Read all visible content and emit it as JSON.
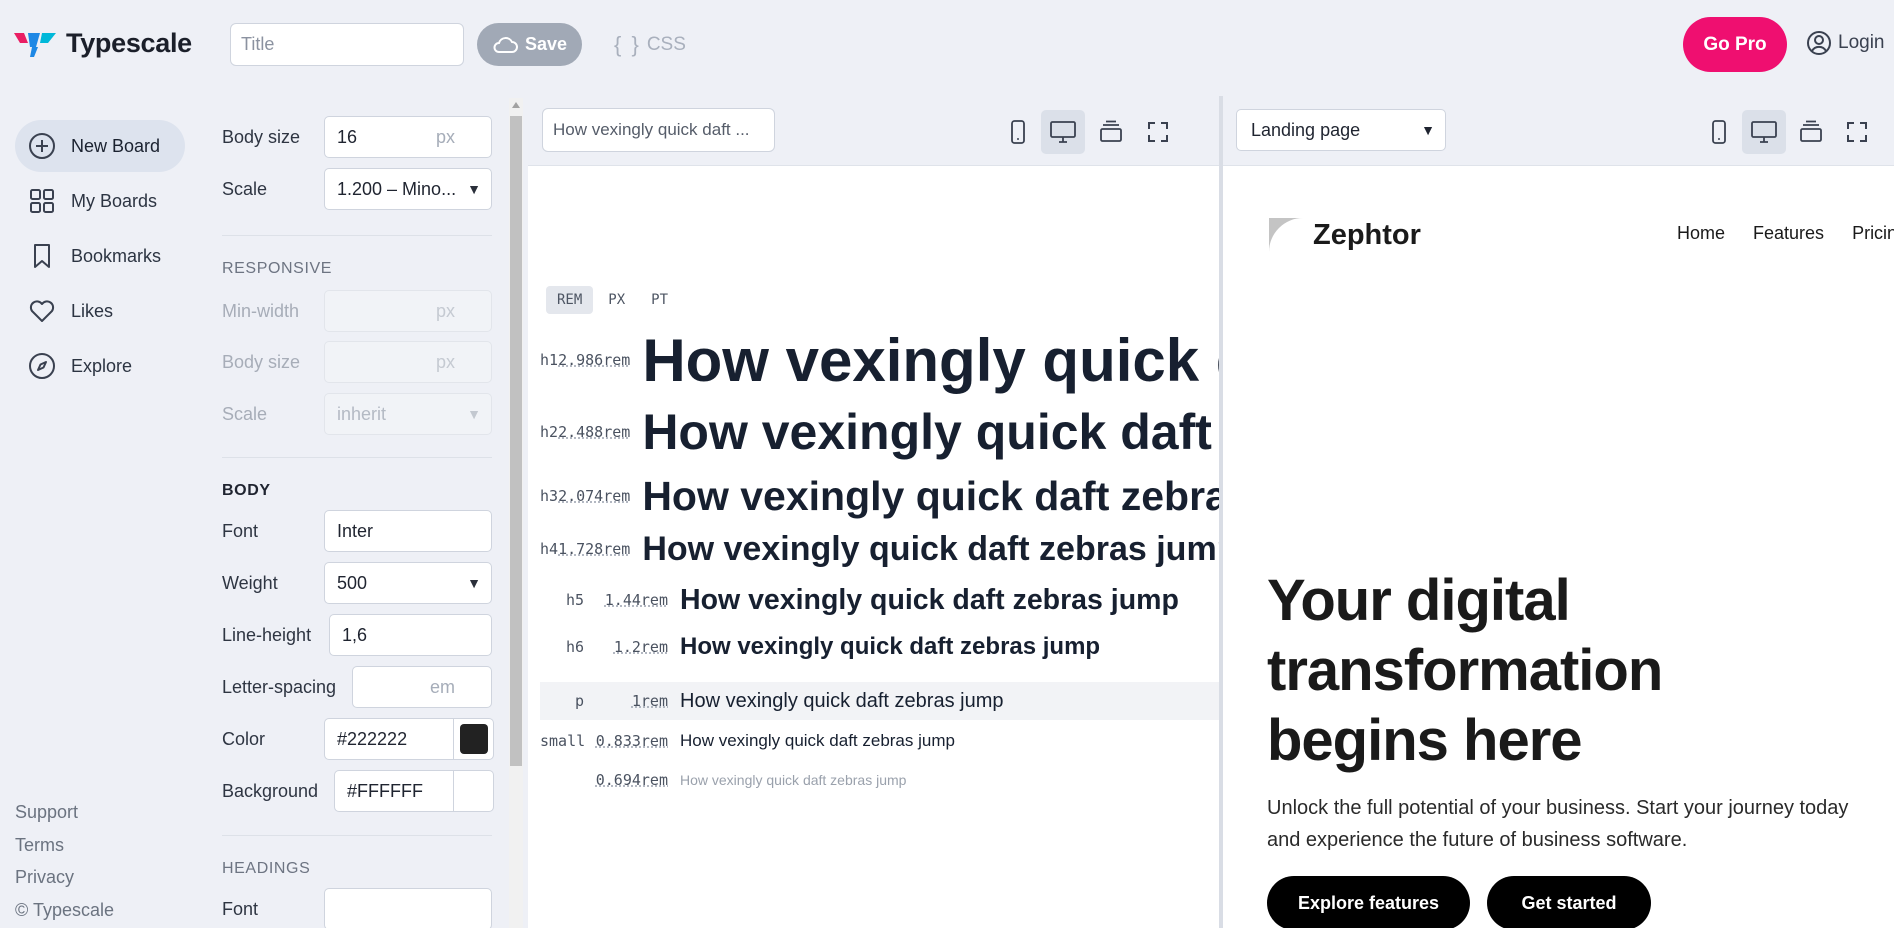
{
  "app": {
    "name": "Typescale",
    "title_placeholder": "Title",
    "save_label": "Save",
    "css_label": "CSS",
    "go_pro_label": "Go Pro",
    "login_label": "Login",
    "accent_color": "#ef0f70"
  },
  "nav": {
    "items": [
      {
        "label": "New Board",
        "icon": "plus-circle-icon",
        "active": true
      },
      {
        "label": "My Boards",
        "icon": "grid-icon"
      },
      {
        "label": "Bookmarks",
        "icon": "bookmark-icon"
      },
      {
        "label": "Likes",
        "icon": "heart-icon"
      },
      {
        "label": "Explore",
        "icon": "compass-icon"
      }
    ],
    "footer": [
      "Support",
      "Terms",
      "Privacy",
      "© Typescale"
    ]
  },
  "settings": {
    "body_size_label": "Body size",
    "body_size_value": "16",
    "px_unit": "px",
    "scale_label": "Scale",
    "scale_value": "1.200 – Mino...",
    "responsive_title": "RESPONSIVE",
    "min_width_label": "Min-width",
    "resp_body_size_label": "Body size",
    "resp_scale_label": "Scale",
    "resp_scale_value": "inherit",
    "body_title": "BODY",
    "font_label": "Font",
    "font_value": "Inter",
    "weight_label": "Weight",
    "weight_value": "500",
    "line_height_label": "Line-height",
    "line_height_value": "1,6",
    "letter_spacing_label": "Letter-spacing",
    "em_unit": "em",
    "color_label": "Color",
    "color_value": "#222222",
    "background_label": "Background",
    "background_value": "#FFFFFF",
    "headings_title": "HEADINGS",
    "headings_font_label": "Font"
  },
  "preview": {
    "sample_text_input": "How vexingly quick daft ...",
    "units": [
      "REM",
      "PX",
      "PT"
    ],
    "active_unit": "REM",
    "sample_text": "How vexingly quick daft zebras jump",
    "rows": [
      {
        "tag": "h1",
        "size": "2.986rem"
      },
      {
        "tag": "h2",
        "size": "2.488rem"
      },
      {
        "tag": "h3",
        "size": "2.074rem"
      },
      {
        "tag": "h4",
        "size": "1.728rem"
      },
      {
        "tag": "h5",
        "size": "1.44rem"
      },
      {
        "tag": "h6",
        "size": "1.2rem"
      },
      {
        "tag": "p",
        "size": "1rem"
      },
      {
        "tag": "small",
        "size": "0.833rem"
      },
      {
        "tag": "",
        "size": "0.694rem"
      }
    ]
  },
  "landing": {
    "page_select_value": "Landing page",
    "brand": "Zephtor",
    "nav_links": [
      "Home",
      "Features",
      "Pricing"
    ],
    "headline": "Your digital transformation begins here",
    "subtext": "Unlock the full potential of your business. Start your journey today and experience the future of business software.",
    "primary_cta": "Explore features",
    "secondary_cta": "Get started"
  }
}
